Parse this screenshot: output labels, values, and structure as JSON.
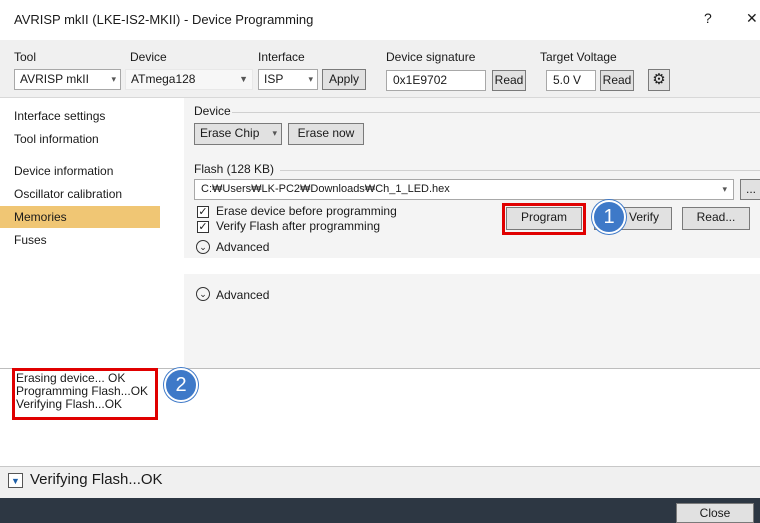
{
  "window": {
    "title": "AVRISP mkII (LKE-IS2-MKII) - Device Programming",
    "help": "?",
    "close": "✕"
  },
  "toolbar": {
    "tool_label": "Tool",
    "tool_value": "AVRISP mkII",
    "device_label": "Device",
    "device_value": "ATmega128",
    "interface_label": "Interface",
    "interface_value": "ISP",
    "apply": "Apply",
    "signature_label": "Device signature",
    "signature_value": "0x1E9702",
    "signature_read": "Read",
    "voltage_label": "Target Voltage",
    "voltage_value": "5.0 V",
    "voltage_read": "Read",
    "settings_icon": "gear-icon"
  },
  "sidebar": {
    "items": [
      {
        "label": "Interface settings"
      },
      {
        "label": "Tool information"
      },
      {
        "label": "Device information"
      },
      {
        "label": "Oscillator calibration"
      },
      {
        "label": "Memories"
      },
      {
        "label": "Fuses"
      }
    ]
  },
  "device_group": {
    "title": "Device",
    "erase_mode": "Erase Chip",
    "erase_now": "Erase now"
  },
  "flash_group": {
    "title": "Flash (128 KB)",
    "file_path": "C:₩Users₩LK-PC2₩Downloads₩Ch_1_LED.hex",
    "browse": "...",
    "erase_before": "Erase device before programming",
    "verify_after": "Verify Flash after programming",
    "program": "Program",
    "verify": "Verify",
    "read": "Read...",
    "advanced": "Advanced"
  },
  "lower": {
    "advanced": "Advanced"
  },
  "annotations": {
    "badge1": "1",
    "badge2": "2"
  },
  "log": [
    "Erasing device... OK",
    "Programming Flash...OK",
    "Verifying Flash...OK"
  ],
  "status": {
    "text": "Verifying Flash...OK"
  },
  "footer": {
    "close": "Close"
  },
  "colors": {
    "selected": "#f0c674",
    "highlight": "#e00000",
    "badge": "#3e79c8",
    "footer": "#2d3743"
  }
}
